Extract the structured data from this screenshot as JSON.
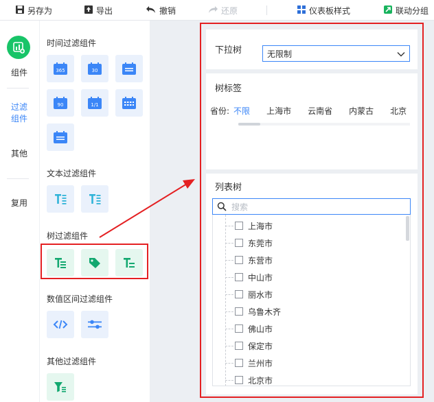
{
  "toolbar": {
    "save_as": "另存为",
    "export": "导出",
    "undo": "撤销",
    "redo": "还原",
    "dashboard_style": "仪表板样式",
    "linkage_group": "联动分组"
  },
  "rail": {
    "components": "组件",
    "filter": "过滤组件",
    "other": "其他",
    "reuse": "复用"
  },
  "panel": {
    "time_filter": "时间过滤组件",
    "text_filter": "文本过滤组件",
    "tree_filter": "树过滤组件",
    "range_filter": "数值区间过滤组件",
    "other_filter": "其他过滤组件",
    "tile_labels": [
      "365",
      "30",
      "90",
      "1/1"
    ]
  },
  "dropdown_tree": {
    "title": "下拉树",
    "value": "无限制"
  },
  "tree_tag": {
    "title": "树标签",
    "prefix": "省份:",
    "tags": [
      "不限",
      "上海市",
      "云南省",
      "内蒙古",
      "北京"
    ]
  },
  "list_tree": {
    "title": "列表树",
    "search_placeholder": "搜索",
    "items": [
      "上海市",
      "东莞市",
      "东营市",
      "中山市",
      "丽水市",
      "乌鲁木齐",
      "佛山市",
      "保定市",
      "兰州市",
      "北京市"
    ]
  },
  "colors": {
    "accent": "#3b86f7",
    "green": "#18c468",
    "highlight": "#e42022"
  }
}
